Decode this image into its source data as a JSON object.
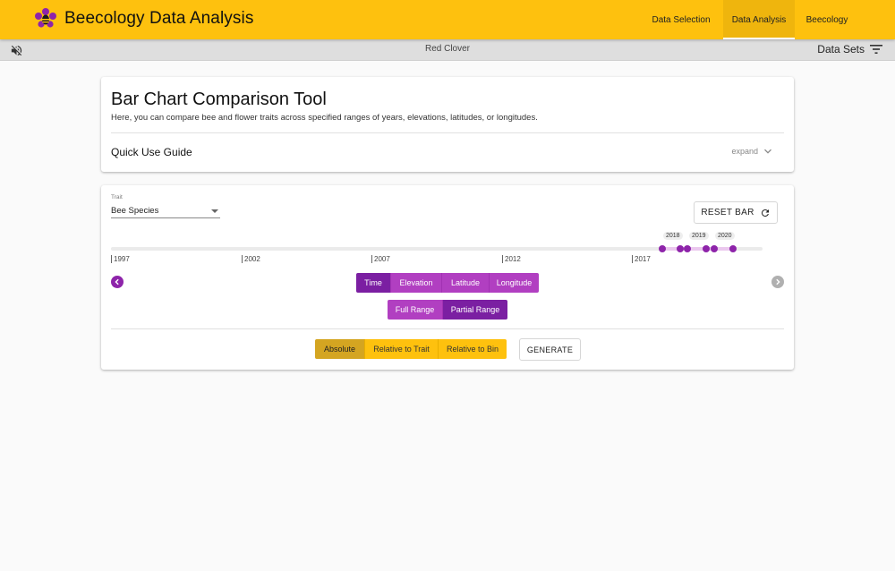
{
  "app": {
    "title": "Beecology Data Analysis",
    "brand_color": "#fec10e",
    "accent_color": "#8e24aa"
  },
  "nav": {
    "items": [
      {
        "label": "Data Selection",
        "active": false
      },
      {
        "label": "Data Analysis",
        "active": true
      },
      {
        "label": "Beecology",
        "active": false
      }
    ]
  },
  "subbar": {
    "dataset_name": "Red Clover",
    "datasets_label": "Data Sets",
    "mute_icon": "volume-off-icon",
    "filter_icon": "filter-list-icon"
  },
  "intro": {
    "title": "Bar Chart Comparison Tool",
    "description": "Here, you can compare bee and flower traits across specified ranges of years, elevations, latitudes, or longitudes.",
    "guide_title": "Quick Use Guide",
    "expand_label": "expand"
  },
  "controls": {
    "trait_label": "Trait",
    "trait_value": "Bee Species",
    "reset_label": "RESET BAR",
    "timeline": {
      "tick_labels": [
        "1997",
        "2002",
        "2007",
        "2012",
        "2017"
      ],
      "year_bubbles": [
        "2018",
        "2019",
        "2020"
      ]
    },
    "axis_options": [
      {
        "label": "Time",
        "selected": true
      },
      {
        "label": "Elevation",
        "selected": false
      },
      {
        "label": "Latitude",
        "selected": false
      },
      {
        "label": "Longitude",
        "selected": false
      }
    ],
    "range_options": [
      {
        "label": "Full Range",
        "selected": false
      },
      {
        "label": "Partial Range",
        "selected": true
      }
    ],
    "mode_options": [
      {
        "label": "Absolute",
        "selected": true
      },
      {
        "label": "Relative to Trait",
        "selected": false
      },
      {
        "label": "Relative to Bin",
        "selected": false
      }
    ],
    "generate_label": "GENERATE"
  }
}
